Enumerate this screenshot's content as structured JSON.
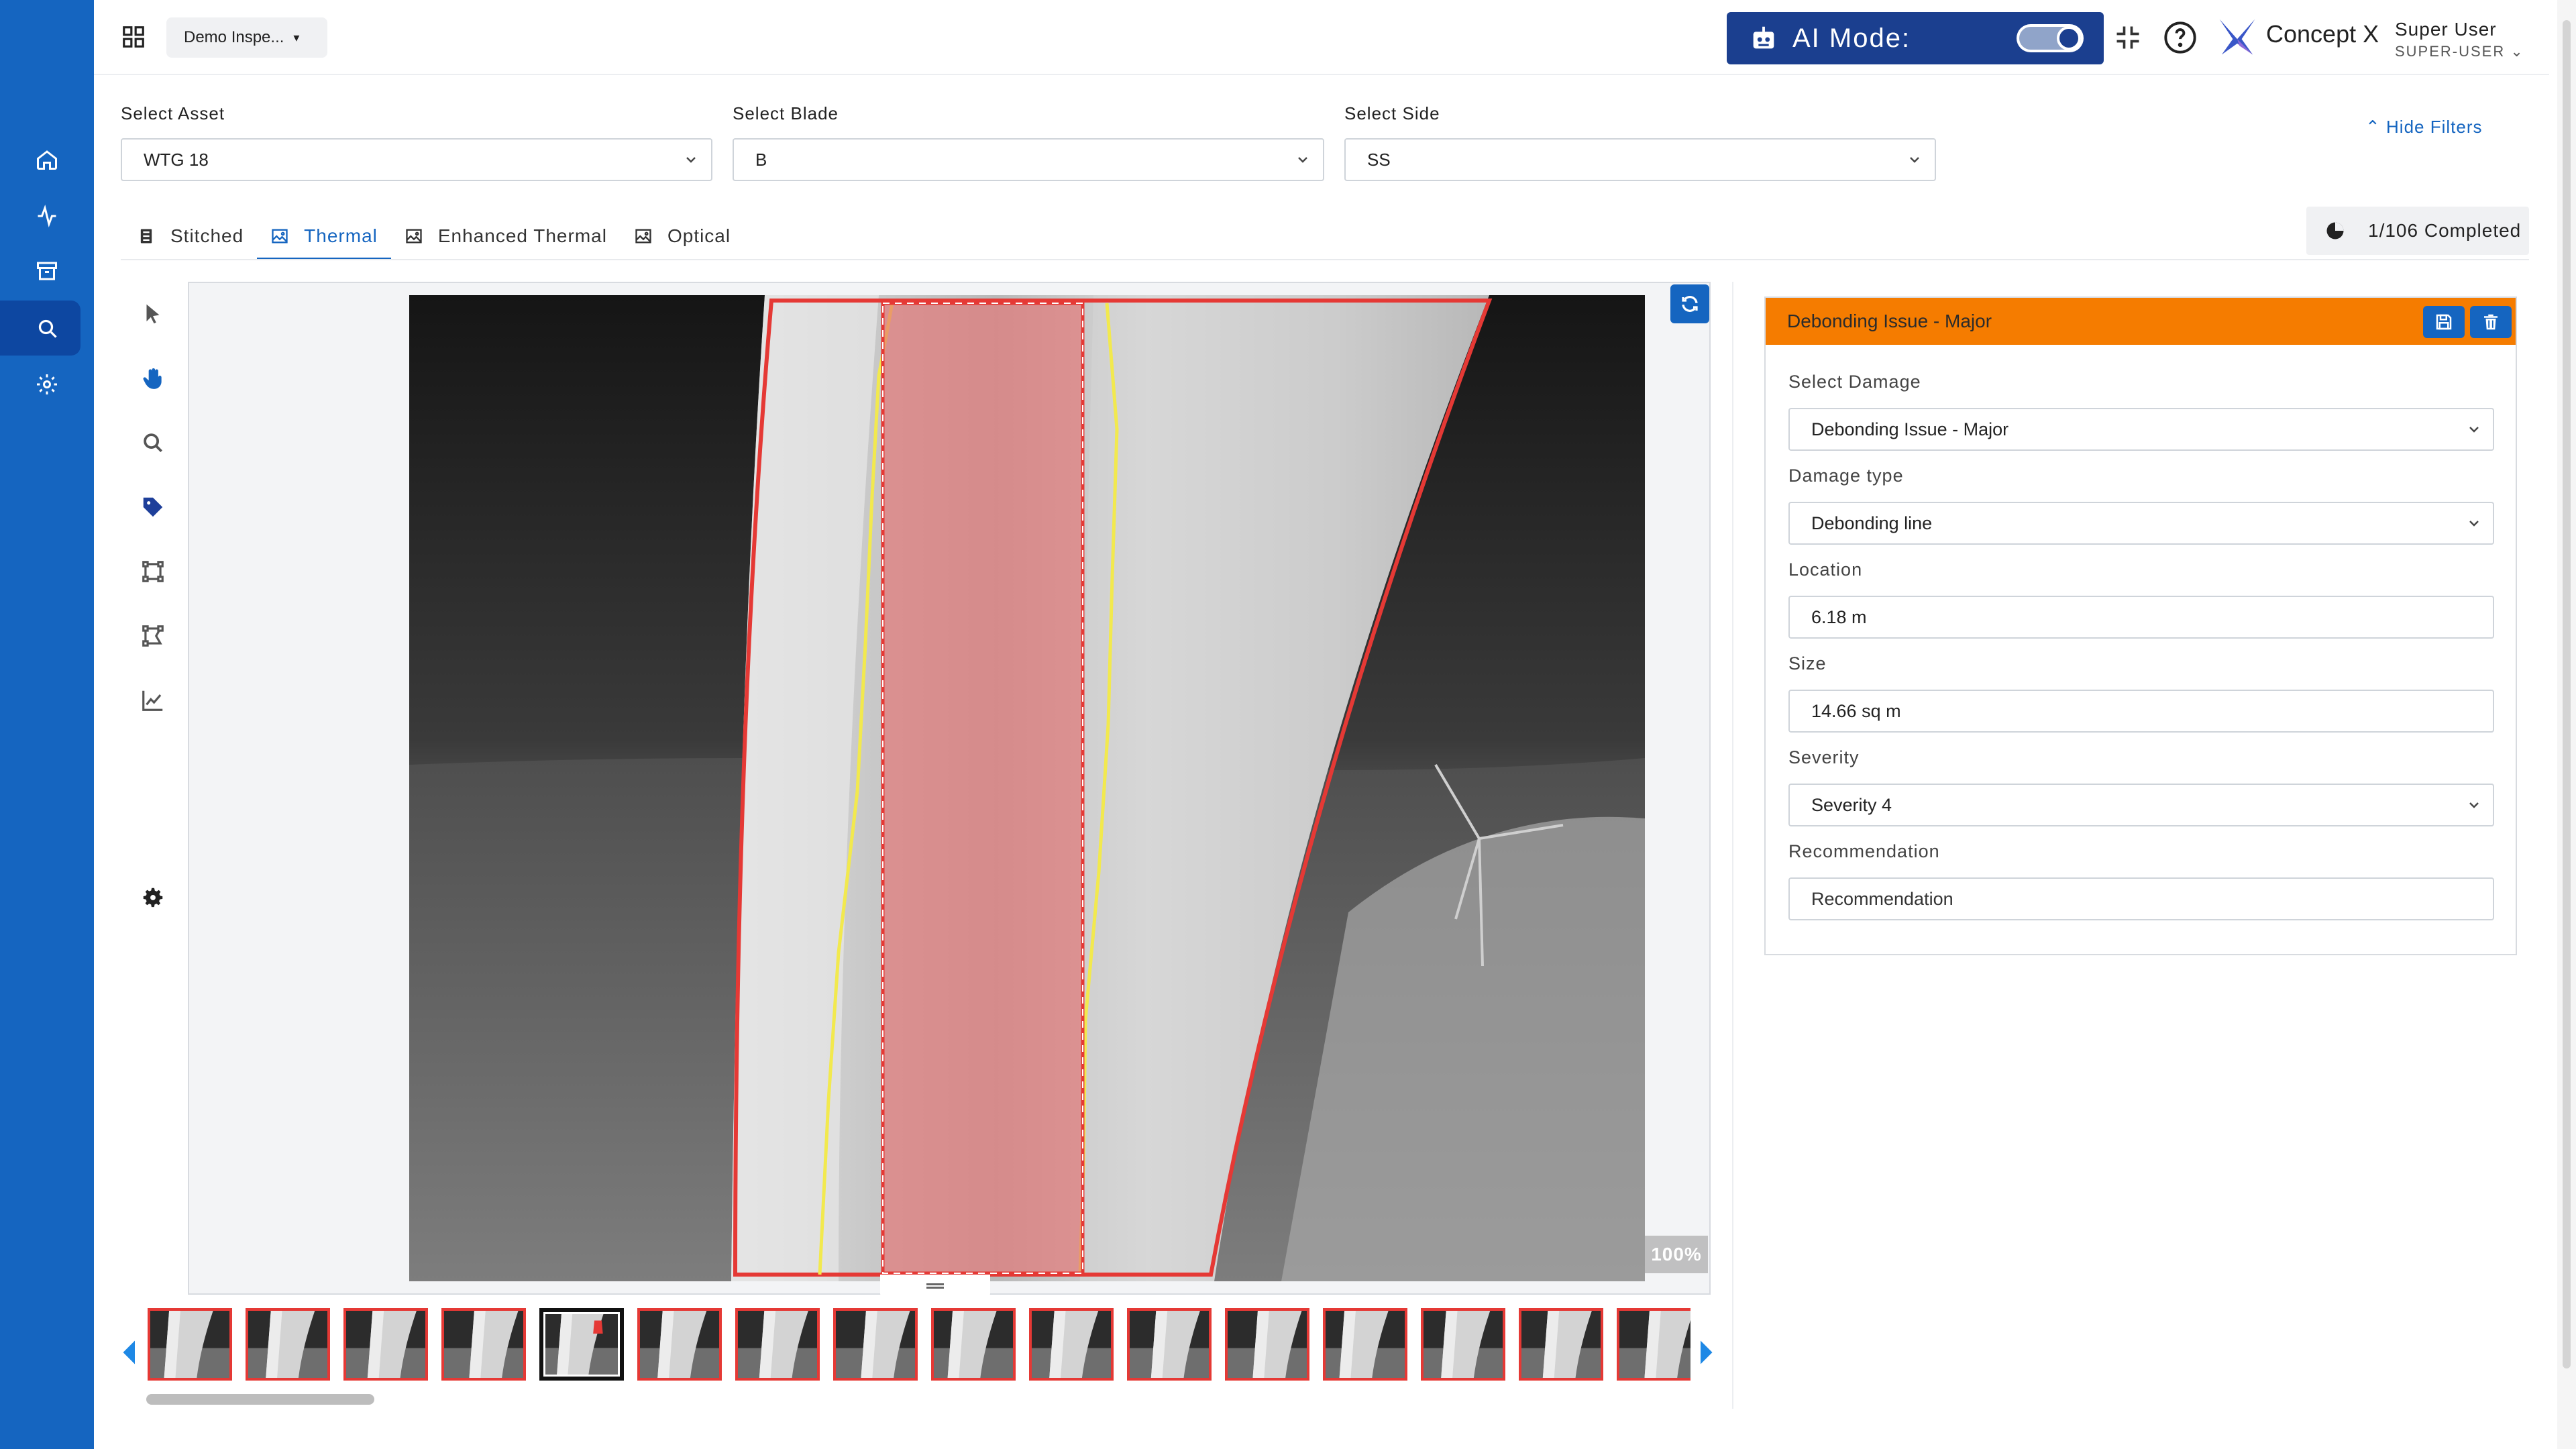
{
  "header": {
    "inspection_label": "Demo Inspe...",
    "ai_mode_label": "AI Mode:",
    "brand": "Concept X",
    "user_name": "Super User",
    "user_role": "SUPER-USER"
  },
  "filters": {
    "asset_label": "Select Asset",
    "asset_value": "WTG 18",
    "blade_label": "Select Blade",
    "blade_value": "B",
    "side_label": "Select Side",
    "side_value": "SS",
    "hide_filters": "Hide Filters"
  },
  "tabs": [
    {
      "label": "Stitched",
      "icon": "stitched-icon"
    },
    {
      "label": "Thermal",
      "icon": "image-icon"
    },
    {
      "label": "Enhanced Thermal",
      "icon": "image-icon"
    },
    {
      "label": "Optical",
      "icon": "image-icon"
    }
  ],
  "active_tab": "Thermal",
  "completed": "1/106 Completed",
  "viewer": {
    "zoom": "100%"
  },
  "filmstrip": {
    "thumb_count": 16,
    "selected_index": 4
  },
  "panel": {
    "title": "Debonding Issue - Major",
    "header_color": "#f57c00",
    "damage_label": "Select Damage",
    "damage_value": "Debonding Issue - Major",
    "type_label": "Damage type",
    "type_value": "Debonding line",
    "location_label": "Location",
    "location_value": "6.18 m",
    "size_label": "Size",
    "size_value": "14.66 sq m",
    "severity_label": "Severity",
    "severity_value": "Severity 4",
    "recommendation_label": "Recommendation",
    "recommendation_placeholder": "Recommendation"
  },
  "colors": {
    "primary": "#1565c0",
    "ai_mode_bg": "#1b3f8f",
    "annotation_red": "#e53935",
    "annotation_yellow": "#f2e94e"
  }
}
